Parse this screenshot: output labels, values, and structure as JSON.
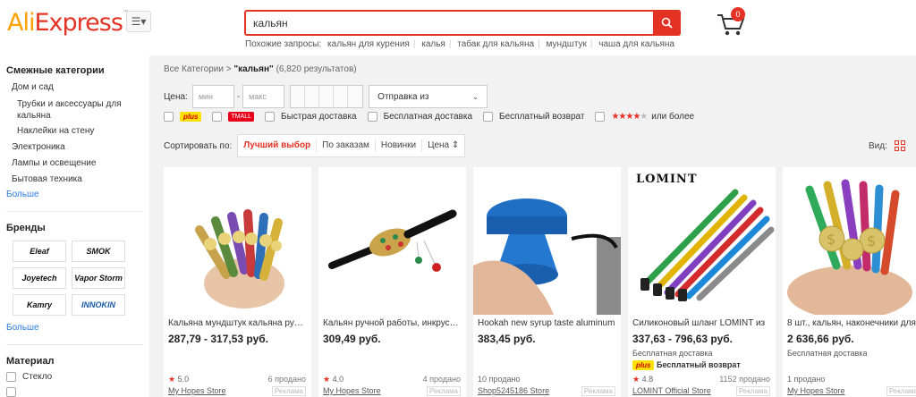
{
  "header": {
    "logo_left": "Ali",
    "logo_right": "Express",
    "search_value": "кальян",
    "related_label": "Похожие запросы:",
    "related": [
      "кальян для курения",
      "калья",
      "табак для кальяна",
      "мундштук",
      "чаша для кальяна"
    ],
    "cart_count": "0"
  },
  "sidebar": {
    "categories_title": "Смежные категории",
    "categories": [
      {
        "label": "Дом и сад",
        "indent": 1
      },
      {
        "label": "Трубки и аксессуары для",
        "indent": 2
      },
      {
        "label": "кальяна",
        "indent": 2
      },
      {
        "label": "Наклейки на стену",
        "indent": 2
      },
      {
        "label": "Электроника",
        "indent": 1
      },
      {
        "label": "Лампы и освещение",
        "indent": 1
      },
      {
        "label": "Бытовая техника",
        "indent": 1
      }
    ],
    "more1": "Больше",
    "brands_title": "Бренды",
    "brands": [
      "Eleaf",
      "SMOK",
      "Joyetech",
      "Vapor Storm",
      "Kamry",
      "INNOKIN"
    ],
    "more2": "Больше",
    "material_title": "Материал",
    "materials": [
      "Стекло",
      ""
    ]
  },
  "main": {
    "crumb_root": "Все Категории",
    "crumb_query": "\"кальян\"",
    "crumb_count": "(6,820 результатов)",
    "price_label": "Цена:",
    "price_min_ph": "мин",
    "price_max_ph": "макс",
    "ship_from": "Отправка из",
    "checks": {
      "plus": "plus",
      "tmall": "TMALL",
      "fast": "Быстрая доставка",
      "free_ship": "Бесплатная доставка",
      "free_return": "Бесплатный возврат",
      "stars": "★★★★",
      "stars_grey": "★",
      "or_more": "или более"
    },
    "sort_label": "Сортировать по:",
    "sort": [
      "Лучший выбор",
      "По заказам",
      "Новинки",
      "Цена"
    ],
    "view_label": "Вид:"
  },
  "products": [
    {
      "title": "Кальяна мундштук кальяна ручной работы",
      "price": "287,79 - 317,53 руб.",
      "sub": "",
      "rating": "5.0",
      "sold": "6 продано",
      "store": "My Hopes Store",
      "ad": "Реклама"
    },
    {
      "title": "Кальян ручной работы, инкрустированный",
      "price": "309,49 руб.",
      "sub": "",
      "rating": "4.0",
      "sold": "4 продано",
      "store": "My Hopes Store",
      "ad": "Реклама"
    },
    {
      "title": "Hookah new syrup taste aluminum",
      "price": "383,45 руб.",
      "sub": "",
      "rating": "",
      "sold": "10 продано",
      "store": "Shop5245186 Store",
      "ad": "Реклама"
    },
    {
      "title": "Силиконовый шланг LOMINT из",
      "price": "337,63 - 796,63 руб.",
      "sub": "Бесплатная доставка",
      "plus": "plus",
      "free_return": "Бесплатный возврат",
      "rating": "4.8",
      "sold": "1152 продано",
      "store": "LOMINT Official Store",
      "ad": "Реклама"
    },
    {
      "title": "8 шт., кальян, наконечники для",
      "price": "2 636,66 руб.",
      "sub": "Бесплатная доставка",
      "rating": "",
      "sold": "1 продано",
      "store": "My Hopes Store",
      "ad": "Реклама"
    }
  ],
  "lomint_logo": "LOMINT",
  "colors": {
    "accent": "#e43225",
    "brand_orange": "#ff9f00",
    "link": "#2a7ae2"
  }
}
